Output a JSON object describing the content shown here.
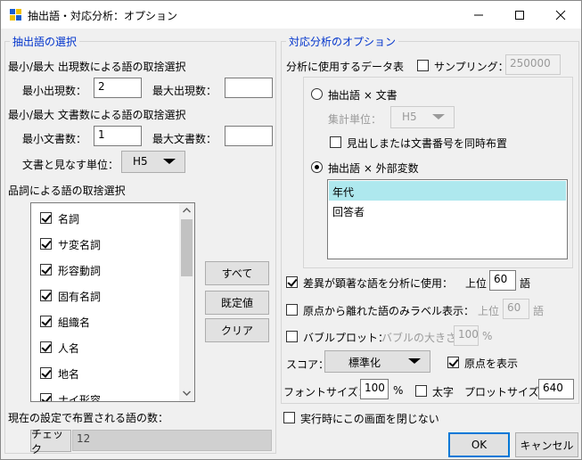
{
  "window": {
    "title": "抽出語・対応分析：オプション"
  },
  "left": {
    "legend": "抽出語の選択",
    "freq_section_label": "最小/最大 出現数による語の取捨選択",
    "min_freq_label": "最小出現数：",
    "min_freq_value": "2",
    "max_freq_label": "最大出現数：",
    "max_freq_value": "",
    "doc_section_label": "最小/最大 文書数による語の取捨選択",
    "min_doc_label": "最小文書数：",
    "min_doc_value": "1",
    "max_doc_label": "最大文書数：",
    "max_doc_value": "",
    "doc_unit_label": "文書と見なす単位：",
    "doc_unit_value": "H5",
    "pos_section_label": "品詞による語の取捨選択",
    "pos_items": [
      {
        "label": "名詞",
        "checked": true
      },
      {
        "label": "サ変名詞",
        "checked": true
      },
      {
        "label": "形容動詞",
        "checked": true
      },
      {
        "label": "固有名詞",
        "checked": true
      },
      {
        "label": "組織名",
        "checked": true
      },
      {
        "label": "人名",
        "checked": true
      },
      {
        "label": "地名",
        "checked": true
      },
      {
        "label": "ナイ形容",
        "checked": true
      }
    ],
    "btn_all": "すべて",
    "btn_default": "既定値",
    "btn_clear": "クリア",
    "count_label": "現在の設定で布置される語の数：",
    "check_button": "チェック",
    "count_value": "12"
  },
  "right": {
    "legend": "対応分析のオプション",
    "data_table_label": "分析に使用するデータ表",
    "sampling_label": "サンプリング：",
    "sampling_checked": false,
    "sampling_value": "250000",
    "radio_word_doc": "抽出語 × 文書",
    "radio_word_doc_selected": false,
    "agg_unit_label": "集計単位：",
    "agg_unit_value": "H5",
    "heading_same_label": "見出しまたは文書番号を同時布置",
    "radio_word_ext": "抽出語 × 外部変数",
    "radio_word_ext_selected": true,
    "variables": [
      {
        "label": "年代",
        "selected": true
      },
      {
        "label": "回答者",
        "selected": false
      }
    ],
    "diff_label": "差異が顕著な語を分析に使用：",
    "diff_checked": true,
    "diff_top_label": "上位",
    "diff_top_value": "60",
    "diff_unit": "語",
    "origin_label_text": "原点から離れた語のみラベル表示：",
    "origin_label_checked": false,
    "origin_top_label": "上位",
    "origin_top_value": "60",
    "origin_unit": "語",
    "bubble_label": "バブルプロット：",
    "bubble_checked": false,
    "bubble_size_label": "バブルの大きさ",
    "bubble_size_value": "100",
    "bubble_unit": "%",
    "score_label": "スコア：",
    "score_value": "標準化",
    "show_origin_label": "原点を表示",
    "show_origin_checked": true,
    "font_size_label": "フォントサイズ：",
    "font_size_value": "100",
    "font_size_unit": "%",
    "bold_label": "太字",
    "bold_checked": false,
    "plot_size_label": "プロットサイズ：",
    "plot_size_value": "640"
  },
  "footer": {
    "close_on_run_label": "実行時にこの画面を閉じない",
    "close_on_run_checked": false,
    "ok": "OK",
    "cancel": "キャンセル"
  },
  "colors": {
    "legend": "#0033cc",
    "selection": "#aee8ee",
    "accent": "#0078d7"
  }
}
